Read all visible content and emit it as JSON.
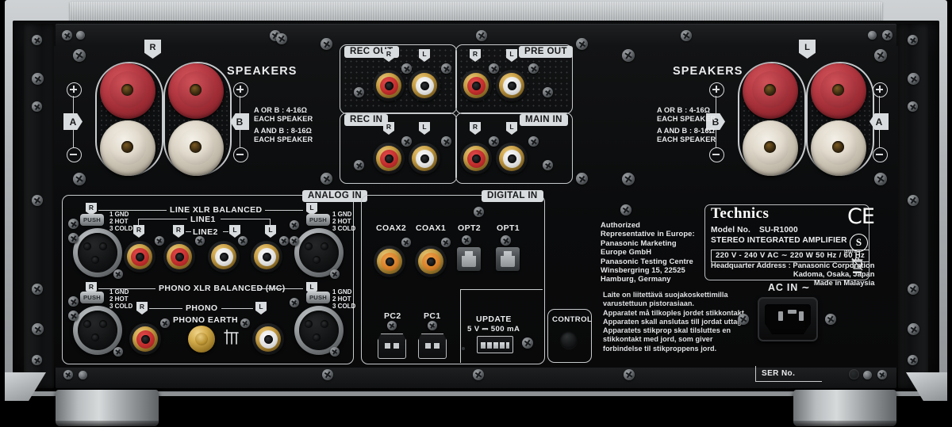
{
  "device": {
    "brand": "Technics",
    "model_label": "Model No.",
    "model_no": "SU-R1000",
    "type": "STEREO INTEGRATED AMPLIFIER",
    "rating": "220 V - 240 V   AC   ∼   220 W   50 Hz / 60 Hz",
    "hq_lines": [
      "Headquarter Address : Panasonic Corporation",
      "Kadoma, Osaka, Japan",
      "Made in Malaysia"
    ],
    "serial_label": "SER No."
  },
  "authorized": {
    "lines": [
      "Authorized",
      "Representative in Europe:",
      "Panasonic Marketing",
      "Europe GmbH",
      "Panasonic Testing Centre",
      "Winsbergring 15, 22525",
      "Hamburg, Germany"
    ]
  },
  "safety": {
    "lines": [
      "Laite on liitettävä suojakoskettimilla",
      "varustettuun  pistorasiaan.",
      "Apparatet må tilkoples jordet stikkontakt.",
      "Apparaten skall anslutas till jordat uttag.",
      "Apparatets stikprop skal tilsluttes en",
      "stikkontakt med jord, som giver",
      "forbindelse til stikproppens jord."
    ]
  },
  "speakers": {
    "title": "SPEAKERS",
    "channel_right": "R",
    "channel_left": "L",
    "tag_a": "A",
    "tag_b": "B",
    "impedance_line1": "A OR B : 4-16Ω",
    "impedance_line2": "EACH SPEAKER",
    "impedance_line3": "A AND B : 8-16Ω",
    "impedance_line4": "EACH SPEAKER"
  },
  "rca_blocks": {
    "rec_out": "REC OUT",
    "pre_out": "PRE OUT",
    "rec_in": "REC IN",
    "main_in": "MAIN IN",
    "ch_r": "R",
    "ch_l": "L"
  },
  "analog_in": {
    "section_label": "ANALOG IN",
    "line_xlr": "LINE XLR BALANCED",
    "line1": "LINE1",
    "line2": "LINE2",
    "phono_xlr": "PHONO XLR BALANCED (MC)",
    "phono": "PHONO",
    "phono_earth": "PHONO EARTH",
    "ch_r": "R",
    "ch_l": "L",
    "pin1": "1 GND",
    "pin2": "2 HOT",
    "pin3": "3 COLD",
    "push": "PUSH"
  },
  "digital_in": {
    "section_label": "DIGITAL IN",
    "coax2": "COAX2",
    "coax1": "COAX1",
    "opt2": "OPT2",
    "opt1": "OPT1",
    "pc2": "PC2",
    "pc1": "PC1",
    "update": "UPDATE",
    "update_spec": "5 V ⎓ 500 mA"
  },
  "control": {
    "label": "CONTROL"
  },
  "power": {
    "ac_in": "AC IN  ∼"
  },
  "marks": {
    "ce": "CE",
    "intertek": "S",
    "intertek_sub": "Intertek",
    "weee": "weee-bin-icon"
  }
}
